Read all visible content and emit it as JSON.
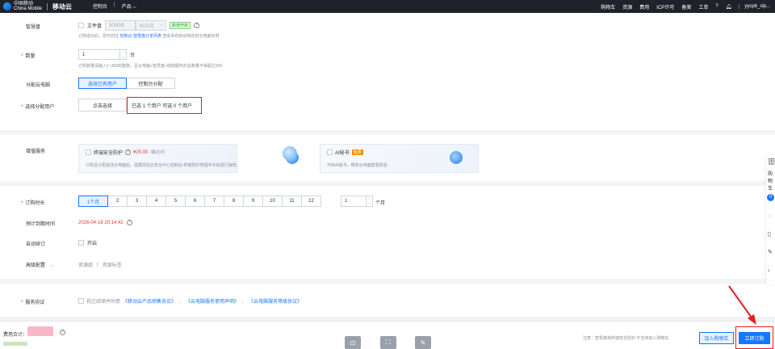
{
  "topbar": {
    "logo_text": "中国移动\nChina Mobile",
    "brand": "移动云",
    "nav": [
      "控制台",
      "产品 ⌵"
    ],
    "right": [
      "购物车",
      "资源",
      "费用",
      "ICP许可",
      "备案",
      "工单"
    ],
    "user": "yycpb_slp..."
  },
  "section1": {
    "smart_disk": {
      "label": "智慧盘",
      "checkbox_label": "文件盘",
      "size_value": "500GB",
      "price_value": "¥10/月",
      "badge": "新增开启",
      "hint": "订购成功后，您可前往",
      "hint_link": "控制台-智慧盘订单列表",
      "hint_tail": "查看系统启动绑定的云电脑实例"
    },
    "quantity": {
      "label": "数量",
      "value": "1",
      "unit": "台",
      "hint": "订购数量请输入1~300的整数。且云电脑+智慧盘+增值服务的总数量不得超过300"
    },
    "assign": {
      "label": "分配云电脑",
      "options": [
        "选择已有用户",
        "控制台分配"
      ]
    },
    "choose_user": {
      "label": "选择分配用户",
      "button": "点击选择",
      "status": "已选 1 个用户 可选 0 个用户"
    }
  },
  "section2": {
    "label": "增值服务",
    "card1": {
      "title": "终端安全防护",
      "price": "¥25.00",
      "unit": "/路径/月",
      "desc": "订购且分配激活云电脑后，需要前往云安全中心控制台-终端防护管理中手动进行接管。"
    },
    "card2": {
      "title": "AI秘书",
      "tag": "免费",
      "desc": "开启AI秘书，畅享云电脑智慧体验"
    }
  },
  "section3": {
    "duration": {
      "label": "订购时长",
      "months": [
        "1个月",
        "2",
        "3",
        "4",
        "5",
        "6",
        "7",
        "8",
        "9",
        "10",
        "11",
        "12"
      ],
      "custom_value": "1",
      "custom_unit": "个月"
    },
    "expire": {
      "label": "预计到期时间",
      "value": "2026-04-18 20:14:42"
    },
    "auto_renew": {
      "label": "自动续订",
      "checkbox_label": "开启"
    },
    "advanced": {
      "label": "高级配置",
      "items": [
        "资源组",
        "资源标签"
      ]
    }
  },
  "section4": {
    "label": "服务协议",
    "prefix": "我已阅读并同意",
    "links": [
      "《移动云产品销售协议》",
      "《云电脑服务使用声明》",
      "《云电脑服务等级协议》"
    ]
  },
  "footer": {
    "total_label": "费用合计：",
    "note": "注意：智慧盘和终端安全防护 不支持加入购物车",
    "add_cart": "加入购物车",
    "buy_now": "立即订购"
  },
  "float_bar": [
    "购",
    "物",
    "车",
    "0"
  ],
  "colors": {
    "accent": "#1677ff",
    "danger": "#e41e1e",
    "price": "#e53935",
    "tag_orange": "#ff8a00"
  }
}
